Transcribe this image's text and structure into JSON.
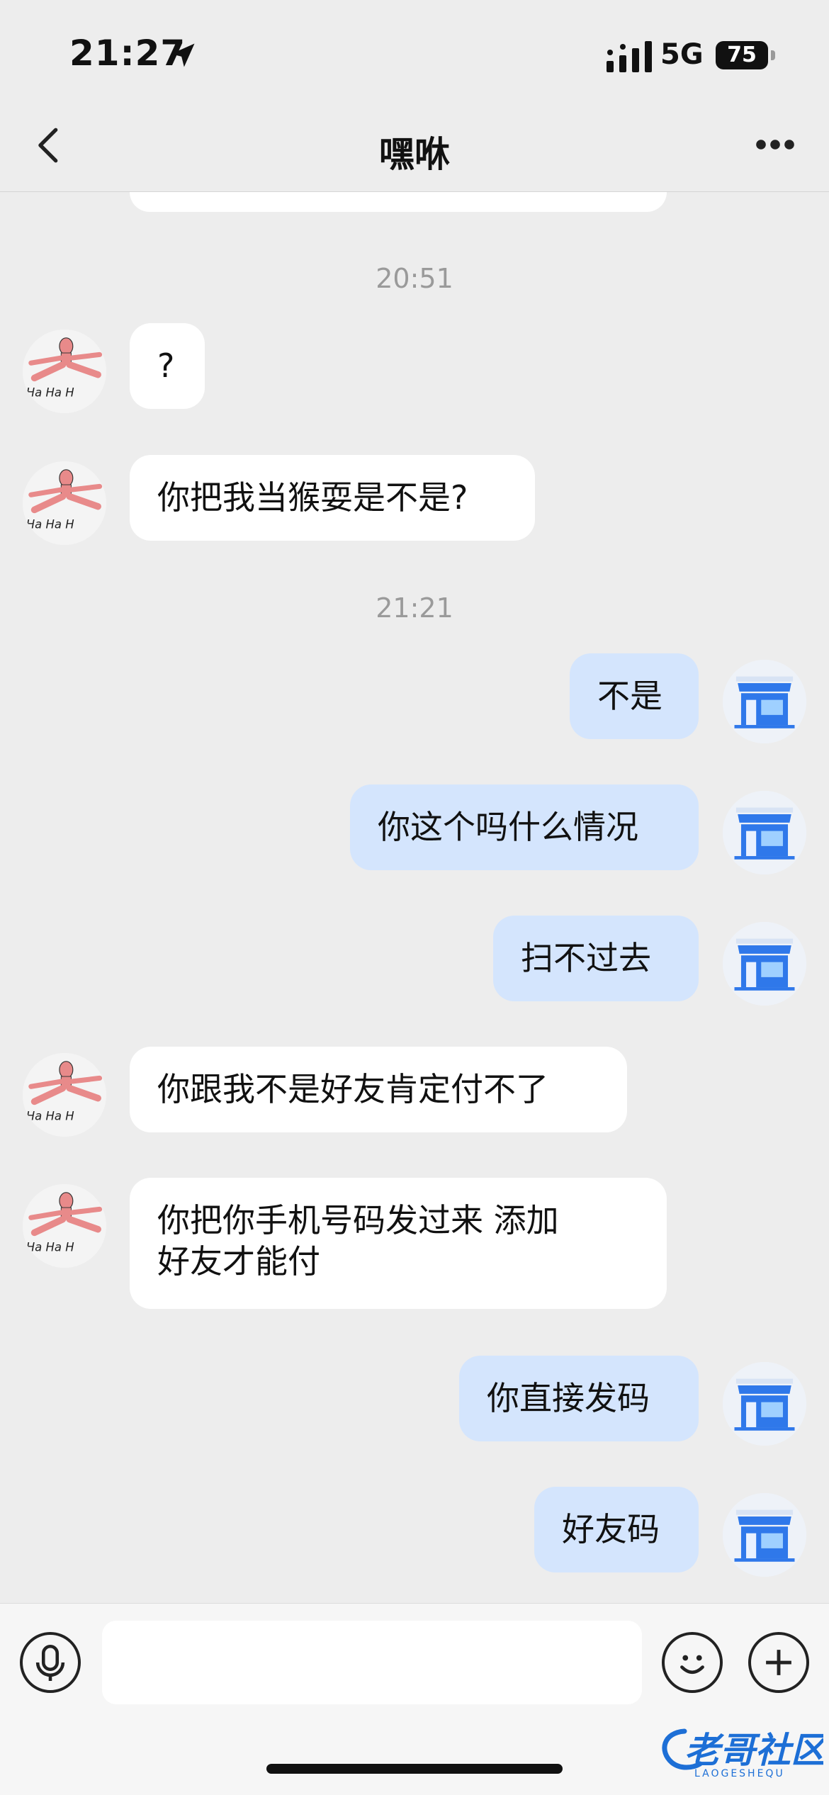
{
  "status_bar": {
    "time": "21:27",
    "network": "5G",
    "battery": "75"
  },
  "header": {
    "title": "嘿咻"
  },
  "messages": [
    {
      "type": "time",
      "text": "20:51"
    },
    {
      "type": "in",
      "text": "?"
    },
    {
      "type": "in",
      "text": "你把我当猴耍是不是?"
    },
    {
      "type": "time",
      "text": "21:21"
    },
    {
      "type": "out",
      "text": "不是"
    },
    {
      "type": "out",
      "text": "你这个吗什么情况"
    },
    {
      "type": "out",
      "text": "扫不过去"
    },
    {
      "type": "in",
      "text": "你跟我不是好友肯定付不了"
    },
    {
      "type": "in",
      "text": "你把你手机号码发过来 添加\n好友才能付"
    },
    {
      "type": "out",
      "text": "你直接发码"
    },
    {
      "type": "out",
      "text": "好友码"
    }
  ],
  "avatar_left": {
    "icon": "stick-figure-hahaha-avatar",
    "caption": "Ha Ha H"
  },
  "avatar_right": {
    "icon": "blue-storefront-avatar"
  },
  "input_bar": {
    "placeholder": "",
    "voice_icon": "microphone-icon",
    "emoji_icon": "smiley-icon",
    "plus_icon": "plus-icon"
  },
  "watermark": {
    "text": "老哥社区",
    "sub": "LAOGESHEQU"
  },
  "colors": {
    "background": "#ededed",
    "incoming_bubble": "#ffffff",
    "outgoing_bubble": "#d4e5fd",
    "timestamp": "#9a9a9a"
  }
}
